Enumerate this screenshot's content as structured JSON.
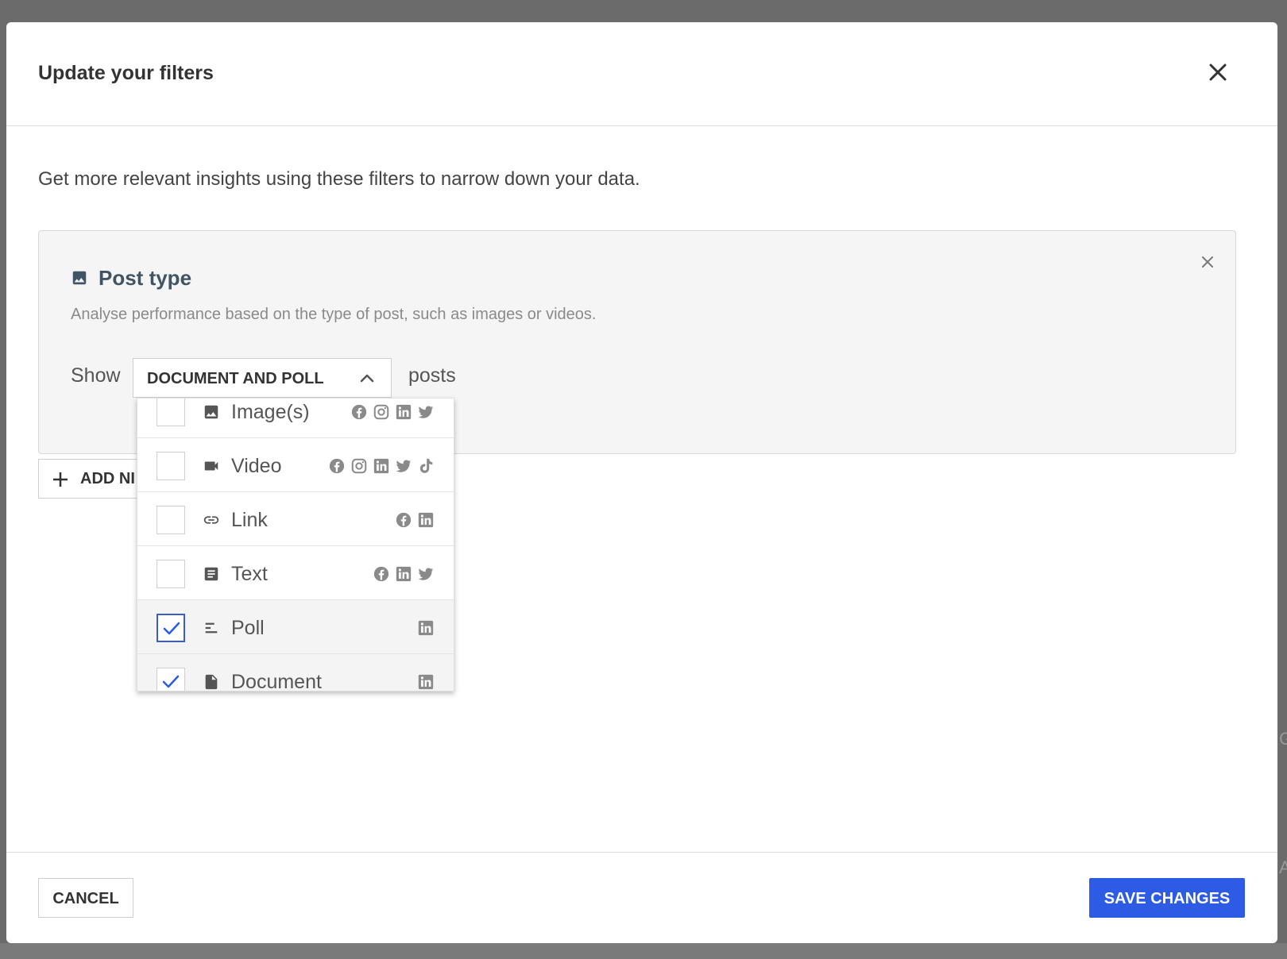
{
  "modal": {
    "title": "Update your filters",
    "intro": "Get more relevant insights using these filters to narrow down your data."
  },
  "filter_card": {
    "title": "Post type",
    "icon": "image-icon",
    "description": "Analyse performance based on the type of post, such as images or videos.",
    "show_label": "Show",
    "selected_value": "DOCUMENT AND POLL",
    "suffix_label": "posts"
  },
  "add_filter": {
    "label": "ADD NI",
    "icon": "plus-icon"
  },
  "dropdown": {
    "options": [
      {
        "label": "Image(s)",
        "icon": "image-icon",
        "checked": false,
        "platforms": [
          "facebook",
          "instagram",
          "linkedin",
          "twitter"
        ]
      },
      {
        "label": "Video",
        "icon": "videocam-icon",
        "checked": false,
        "platforms": [
          "facebook",
          "instagram",
          "linkedin",
          "twitter",
          "tiktok"
        ]
      },
      {
        "label": "Link",
        "icon": "link-icon",
        "checked": false,
        "platforms": [
          "facebook",
          "linkedin"
        ]
      },
      {
        "label": "Text",
        "icon": "article-icon",
        "checked": false,
        "platforms": [
          "facebook",
          "linkedin",
          "twitter"
        ]
      },
      {
        "label": "Poll",
        "icon": "poll-icon",
        "checked": true,
        "platforms": [
          "linkedin"
        ]
      },
      {
        "label": "Document",
        "icon": "document-icon",
        "checked": true,
        "platforms": [
          "linkedin"
        ]
      }
    ]
  },
  "footer": {
    "cancel_label": "CANCEL",
    "save_label": "SAVE CHANGES"
  },
  "colors": {
    "accent": "#2d5be3",
    "overlay": "#6b6b6b",
    "card_title": "#3f5566"
  }
}
